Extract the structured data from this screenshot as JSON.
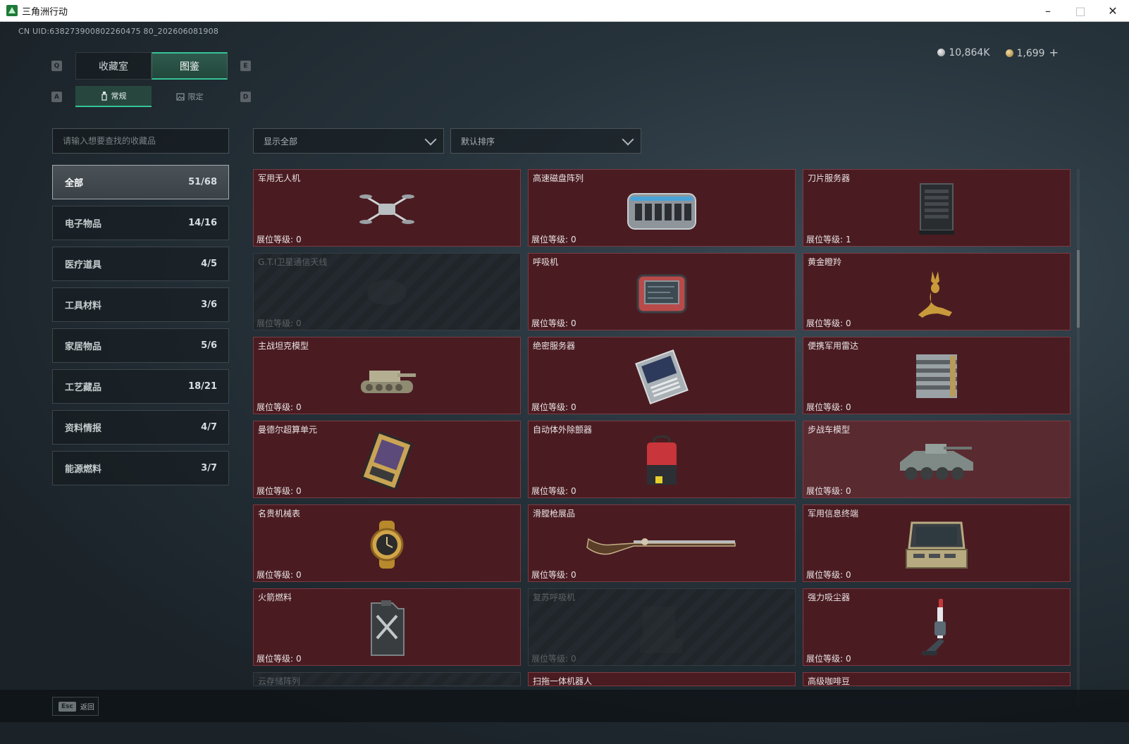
{
  "window": {
    "title": "三角洲行动"
  },
  "uid": "CN UID:638273900802260475 80_202606081908",
  "currency": {
    "silver": "10,864K",
    "gold": "1,699",
    "plus": "+"
  },
  "keys": {
    "q": "Q",
    "e": "E",
    "a": "A",
    "d": "D"
  },
  "tabs": [
    "收藏室",
    "图鉴"
  ],
  "subtabs": [
    "常规",
    "限定"
  ],
  "search": {
    "placeholder": "请输入想要查找的收藏品"
  },
  "filters": {
    "show": "显示全部",
    "sort": "默认排序"
  },
  "categories": [
    {
      "label": "全部",
      "count": "51/68"
    },
    {
      "label": "电子物品",
      "count": "14/16"
    },
    {
      "label": "医疗道具",
      "count": "4/5"
    },
    {
      "label": "工具材料",
      "count": "3/6"
    },
    {
      "label": "家居物品",
      "count": "5/6"
    },
    {
      "label": "工艺藏品",
      "count": "18/21"
    },
    {
      "label": "资料情报",
      "count": "4/7"
    },
    {
      "label": "能源燃料",
      "count": "3/7"
    }
  ],
  "level_prefix": "展位等级:",
  "items": [
    {
      "name": "军用无人机",
      "level": "0",
      "icon": "drone-icon",
      "locked": false
    },
    {
      "name": "高速磁盘阵列",
      "level": "0",
      "icon": "disk-array-icon",
      "locked": false
    },
    {
      "name": "刀片服务器",
      "level": "1",
      "icon": "blade-server-icon",
      "locked": false
    },
    {
      "name": "G.T.I卫星通信天线",
      "level": "0",
      "icon": "satellite-dish-icon",
      "locked": true
    },
    {
      "name": "呼吸机",
      "level": "0",
      "icon": "ventilator-icon",
      "locked": false
    },
    {
      "name": "黄金瞪羚",
      "level": "0",
      "icon": "gold-gazelle-icon",
      "locked": false
    },
    {
      "name": "主战坦克模型",
      "level": "0",
      "icon": "tank-model-icon",
      "locked": false
    },
    {
      "name": "绝密服务器",
      "level": "0",
      "icon": "server-board-icon",
      "locked": false
    },
    {
      "name": "便携军用雷达",
      "level": "0",
      "icon": "radar-icon",
      "locked": false
    },
    {
      "name": "曼德尔超算单元",
      "level": "0",
      "icon": "supercomputer-chip-icon",
      "locked": false
    },
    {
      "name": "自动体外除颤器",
      "level": "0",
      "icon": "defibrillator-icon",
      "locked": false
    },
    {
      "name": "步战车模型",
      "level": "0",
      "icon": "ifv-model-icon",
      "locked": false
    },
    {
      "name": "名贵机械表",
      "level": "0",
      "icon": "watch-icon",
      "locked": false
    },
    {
      "name": "滑膛枪展品",
      "level": "0",
      "icon": "musket-icon",
      "locked": false
    },
    {
      "name": "军用信息终端",
      "level": "0",
      "icon": "terminal-case-icon",
      "locked": false
    },
    {
      "name": "火箭燃料",
      "level": "0",
      "icon": "fuel-can-icon",
      "locked": false
    },
    {
      "name": "复苏呼吸机",
      "level": "0",
      "icon": "resuscitator-icon",
      "locked": true
    },
    {
      "name": "强力吸尘器",
      "level": "0",
      "icon": "vacuum-icon",
      "locked": false
    }
  ],
  "partial_items": [
    {
      "name": "云存储阵列",
      "locked": true
    },
    {
      "name": "扫拖一体机器人",
      "locked": false
    },
    {
      "name": "高级咖啡豆",
      "locked": false
    }
  ],
  "bottom": {
    "key": "Esc",
    "label": "返回"
  }
}
